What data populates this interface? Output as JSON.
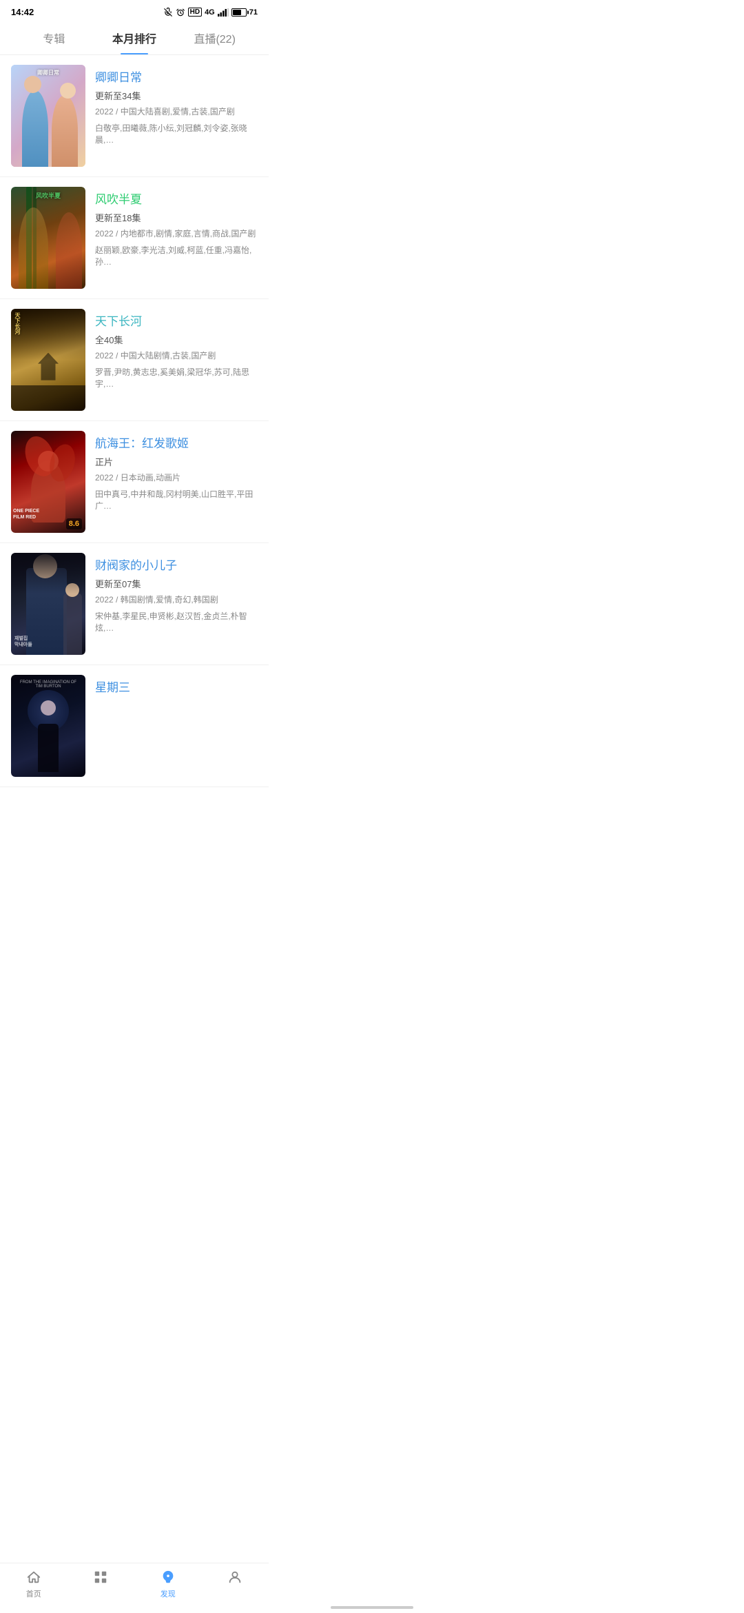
{
  "statusBar": {
    "time": "14:42",
    "batteryLevel": 71
  },
  "tabs": [
    {
      "id": "albums",
      "label": "专辑",
      "active": false
    },
    {
      "id": "monthly",
      "label": "本月排行",
      "active": true
    },
    {
      "id": "live",
      "label": "直播(22)",
      "active": false
    }
  ],
  "shows": [
    {
      "id": 1,
      "title": "卿卿日常",
      "titleColor": "blue",
      "episode": "更新至34集",
      "meta": "2022 / 中国大陆喜剧,爱情,古装,国产剧",
      "cast": "白敬亭,田曦薇,陈小纭,刘冠麟,刘令姿,张晓晨,…",
      "posterClass": "poster-1",
      "rating": null
    },
    {
      "id": 2,
      "title": "风吹半夏",
      "titleColor": "green",
      "episode": "更新至18集",
      "meta": "2022 / 内地都市,剧情,家庭,言情,商战,国产剧",
      "cast": "赵丽颖,欧豪,李光洁,刘威,柯蓝,任重,冯嘉怡,孙…",
      "posterClass": "poster-2",
      "rating": null
    },
    {
      "id": 3,
      "title": "天下长河",
      "titleColor": "teal",
      "episode": "全40集",
      "meta": "2022 / 中国大陆剧情,古装,国产剧",
      "cast": "罗晋,尹昉,黄志忠,奚美娟,梁冠华,苏可,陆思宇,…",
      "posterClass": "poster-3",
      "rating": null
    },
    {
      "id": 4,
      "title": "航海王：红发歌姬",
      "titleColor": "blue",
      "episode": "正片",
      "meta": "2022 / 日本动画,动画片",
      "cast": "田中真弓,中井和哉,冈村明美,山口胜平,平田广…",
      "posterClass": "poster-4",
      "rating": "8.6"
    },
    {
      "id": 5,
      "title": "财阀家的小儿子",
      "titleColor": "blue",
      "episode": "更新至07集",
      "meta": "2022 / 韩国剧情,爱情,奇幻,韩国剧",
      "cast": "宋仲基,李星民,申贤彬,赵汉哲,金贞兰,朴智炫,…",
      "posterClass": "poster-5",
      "rating": null
    },
    {
      "id": 6,
      "title": "星期三",
      "titleColor": "blue",
      "episode": "",
      "meta": "",
      "cast": "",
      "posterClass": "poster-6",
      "rating": null
    }
  ],
  "bottomNav": [
    {
      "id": "home",
      "label": "首页",
      "icon": "home",
      "active": false
    },
    {
      "id": "apps",
      "label": "",
      "icon": "apps",
      "active": false
    },
    {
      "id": "discover",
      "label": "发现",
      "icon": "discover",
      "active": true
    },
    {
      "id": "profile",
      "label": "",
      "icon": "profile",
      "active": false
    }
  ]
}
